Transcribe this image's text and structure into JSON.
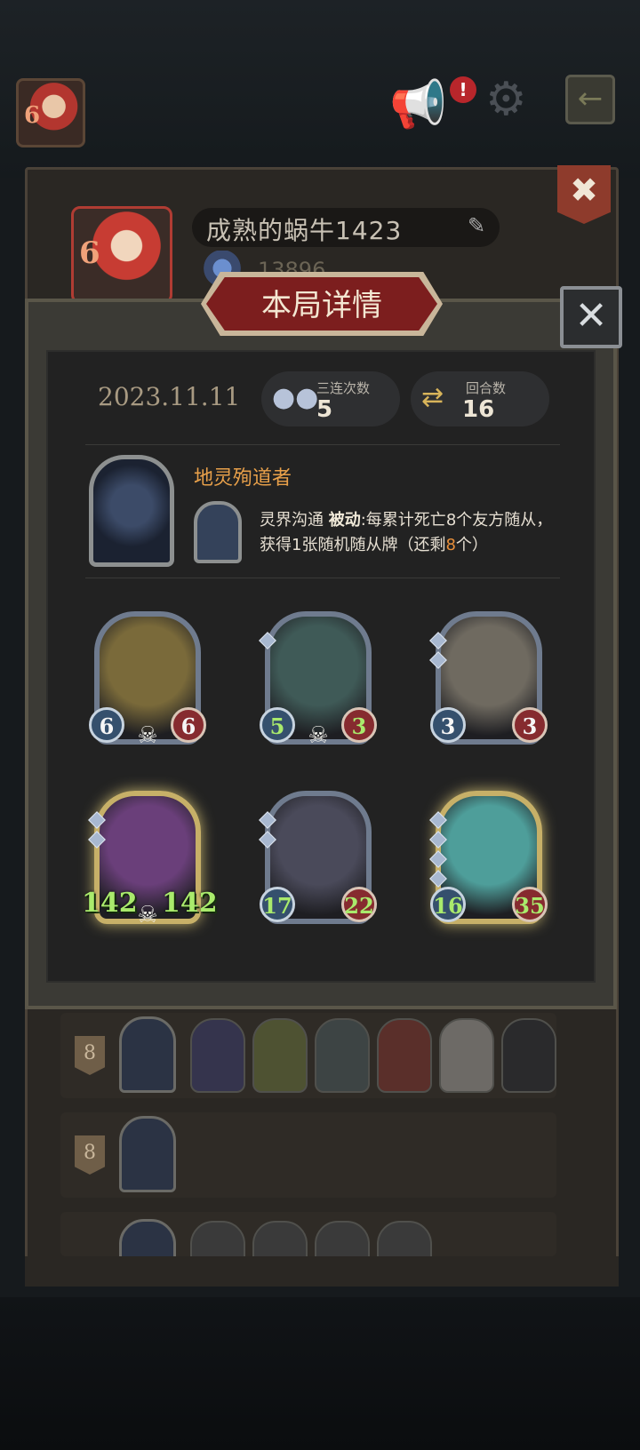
{
  "top_bar": {
    "level_badge": "6",
    "icons": [
      "avatar-icon",
      "megaphone-icon",
      "alert-icon",
      "gear-icon",
      "exit-icon"
    ],
    "alert_mark": "!"
  },
  "profile": {
    "player_name": "成熟的蜗牛1423",
    "score": "13896",
    "level_badge": "6"
  },
  "modal": {
    "title": "本局详情",
    "date": "2023.11.11",
    "triple_label": "三连次数",
    "triple_value": "5",
    "rounds_label": "回合数",
    "rounds_value": "16",
    "hero_name": "地灵殉道者",
    "skill": {
      "name": "灵界沟通",
      "type": "被动",
      "text_a": ":每累计死亡",
      "num_a": "8",
      "text_b": "个友方随从，获得1张随机随从牌（还剩",
      "num_b": "8",
      "text_c": "个）"
    },
    "minions": [
      {
        "atk": "6",
        "hp": "6",
        "stars": 0,
        "gold": false,
        "skull": true,
        "atk_green": false,
        "hp_green": false,
        "icon": "mech-knight"
      },
      {
        "atk": "5",
        "hp": "3",
        "stars": 1,
        "gold": false,
        "skull": true,
        "atk_green": true,
        "hp_green": true,
        "icon": "mimic-chest"
      },
      {
        "atk": "3",
        "hp": "3",
        "stars": 2,
        "gold": false,
        "skull": false,
        "atk_green": false,
        "hp_green": false,
        "icon": "airship"
      },
      {
        "atk": "142",
        "hp": "142",
        "stars": 2,
        "gold": true,
        "skull": true,
        "atk_green": true,
        "hp_green": true,
        "icon": "sea-serpent"
      },
      {
        "atk": "17",
        "hp": "22",
        "stars": 2,
        "gold": false,
        "skull": false,
        "atk_green": true,
        "hp_green": true,
        "icon": "rat-bandit"
      },
      {
        "atk": "16",
        "hp": "35",
        "stars": 4,
        "gold": true,
        "skull": false,
        "atk_green": true,
        "hp_green": true,
        "icon": "ghost-warrior"
      }
    ]
  },
  "history": [
    {
      "rank": "8",
      "units": [
        "unit-1",
        "unit-2",
        "unit-3",
        "unit-4",
        "unit-5",
        "unit-6"
      ]
    },
    {
      "rank": "8",
      "units": []
    },
    {
      "rank": "",
      "units": [
        "unit-1",
        "unit-2",
        "unit-3",
        "unit-4"
      ]
    }
  ]
}
